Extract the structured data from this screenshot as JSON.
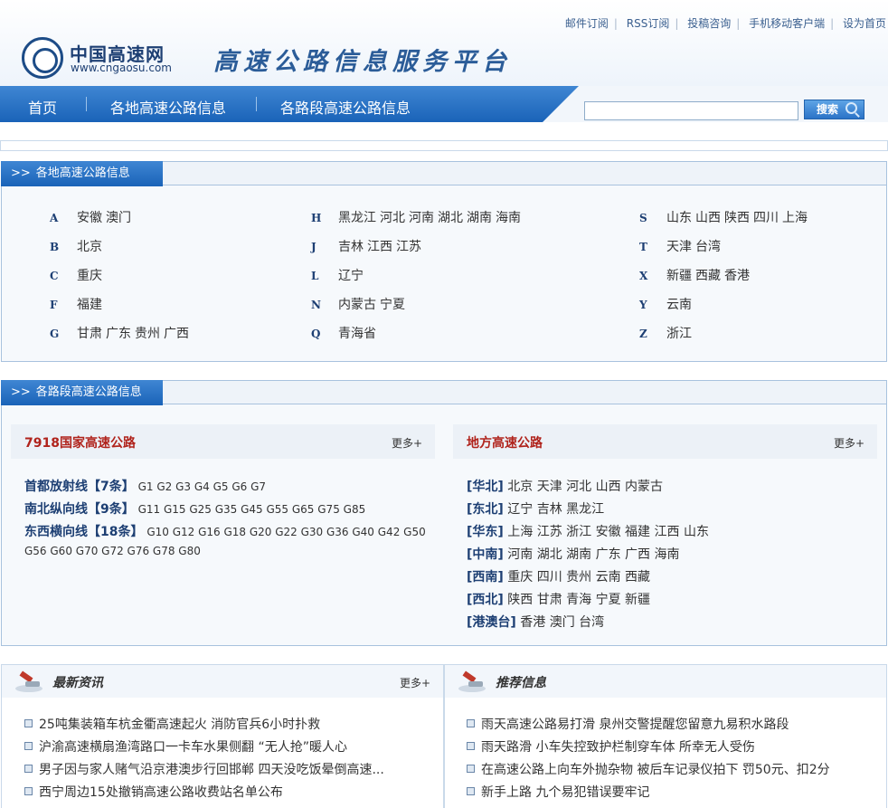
{
  "top_links": [
    "邮件订阅",
    "RSS订阅",
    "投稿咨询",
    "手机移动客户端",
    "设为首页"
  ],
  "logo": {
    "name_cn": "中国高速网",
    "domain": "www.cngaosu.com"
  },
  "platform_title": "高速公路信息服务平台",
  "nav": {
    "items": [
      "首页",
      "各地高速公路信息",
      "各路段高速公路信息"
    ]
  },
  "search": {
    "button_label": "搜索",
    "value": ""
  },
  "regional": {
    "arrow": ">>",
    "tab_title": "各地高速公路信息",
    "columns": [
      [
        {
          "letter": "A",
          "names": [
            "安徽",
            "澳门"
          ]
        },
        {
          "letter": "B",
          "names": [
            "北京"
          ]
        },
        {
          "letter": "C",
          "names": [
            "重庆"
          ]
        },
        {
          "letter": "F",
          "names": [
            "福建"
          ]
        },
        {
          "letter": "G",
          "names": [
            "甘肃",
            "广东",
            "贵州",
            "广西"
          ]
        }
      ],
      [
        {
          "letter": "H",
          "names": [
            "黑龙江",
            "河北",
            "河南",
            "湖北",
            "湖南",
            "海南"
          ]
        },
        {
          "letter": "J",
          "names": [
            "吉林",
            "江西",
            "江苏"
          ]
        },
        {
          "letter": "L",
          "names": [
            "辽宁"
          ]
        },
        {
          "letter": "N",
          "names": [
            "内蒙古",
            "宁夏"
          ]
        },
        {
          "letter": "Q",
          "names": [
            "青海省"
          ]
        }
      ],
      [
        {
          "letter": "S",
          "names": [
            "山东",
            "山西",
            "陕西",
            "四川",
            "上海"
          ]
        },
        {
          "letter": "T",
          "names": [
            "天津",
            "台湾"
          ]
        },
        {
          "letter": "X",
          "names": [
            "新疆",
            "西藏",
            "香港"
          ]
        },
        {
          "letter": "Y",
          "names": [
            "云南"
          ]
        },
        {
          "letter": "Z",
          "names": [
            "浙江"
          ]
        }
      ]
    ]
  },
  "roads": {
    "arrow": ">>",
    "tab_title": "各路段高速公路信息",
    "national": {
      "title": "7918国家高速公路",
      "more": "更多+",
      "lines": [
        {
          "category": "首都放射线",
          "count": "【7条】",
          "codes": "G1 G2 G3 G4 G5 G6 G7"
        },
        {
          "category": "南北纵向线",
          "count": "【9条】",
          "codes": "G11 G15 G25 G35 G45 G55 G65 G75 G85"
        },
        {
          "category": "东西横向线",
          "count": "【18条】",
          "codes": "G10 G12 G16 G18 G20 G22 G30 G36 G40 G42 G50"
        },
        {
          "category": "",
          "count": "",
          "codes": "G56 G60 G70 G72 G76 G78 G80"
        }
      ]
    },
    "local": {
      "title": "地方高速公路",
      "more": "更多+",
      "regions": [
        {
          "region": "[华北]",
          "names": "北京 天津 河北 山西 内蒙古"
        },
        {
          "region": "[东北]",
          "names": "辽宁 吉林 黑龙江"
        },
        {
          "region": "[华东]",
          "names": "上海 江苏 浙江 安徽 福建 江西 山东"
        },
        {
          "region": "[中南]",
          "names": "河南 湖北 湖南 广东 广西 海南"
        },
        {
          "region": "[西南]",
          "names": "重庆 四川 贵州 云南 西藏"
        },
        {
          "region": "[西北]",
          "names": "陕西 甘肃 青海 宁夏 新疆"
        },
        {
          "region": "[港澳台]",
          "names": "香港 澳门 台湾"
        }
      ]
    }
  },
  "news": {
    "title": "最新资讯",
    "more": "更多+",
    "items": [
      "25吨集装箱车杭金衢高速起火 消防官兵6小时扑救",
      "沪渝高速横扇渔湾路口一卡车水果侧翻 “无人抢”暖人心",
      "男子因与家人赌气沿京港澳步行回邯郸 四天没吃饭晕倒高速...",
      "西宁周边15处撤销高速公路收费站名单公布"
    ]
  },
  "recommend": {
    "title": "推荐信息",
    "items": [
      "雨天高速公路易打滑 泉州交警提醒您留意九易积水路段",
      "雨天路滑 小车失控致护栏制穿车体 所幸无人受伤",
      "在高速公路上向车外抛杂物 被后车记录仪拍下 罚50元、扣2分",
      "新手上路 九个易犯错误要牢记"
    ]
  }
}
